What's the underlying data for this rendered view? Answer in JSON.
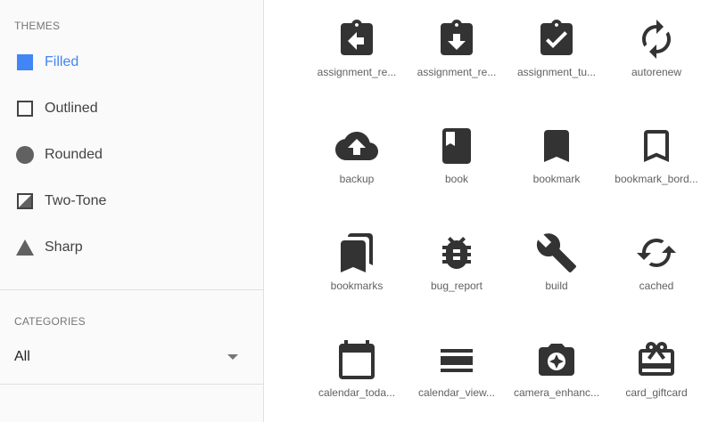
{
  "themes": {
    "heading": "THEMES",
    "items": [
      {
        "label": "Filled",
        "icon": "filled-square-icon",
        "selected": true
      },
      {
        "label": "Outlined",
        "icon": "outlined-square-icon",
        "selected": false
      },
      {
        "label": "Rounded",
        "icon": "rounded-circle-icon",
        "selected": false
      },
      {
        "label": "Two-Tone",
        "icon": "two-tone-icon",
        "selected": false
      },
      {
        "label": "Sharp",
        "icon": "sharp-triangle-icon",
        "selected": false
      }
    ]
  },
  "categories": {
    "heading": "CATEGORIES",
    "selected_value": "All"
  },
  "colors": {
    "accent": "#4285f4",
    "icon": "#333333",
    "sidebar_bg": "#fafafa"
  },
  "icons": [
    {
      "name": "assignment_return",
      "label": "assignment_re..."
    },
    {
      "name": "assignment_returned",
      "label": "assignment_re..."
    },
    {
      "name": "assignment_turned_in",
      "label": "assignment_tu..."
    },
    {
      "name": "autorenew",
      "label": "autorenew"
    },
    {
      "name": "backup",
      "label": "backup"
    },
    {
      "name": "book",
      "label": "book"
    },
    {
      "name": "bookmark",
      "label": "bookmark"
    },
    {
      "name": "bookmark_border",
      "label": "bookmark_bord..."
    },
    {
      "name": "bookmarks",
      "label": "bookmarks"
    },
    {
      "name": "bug_report",
      "label": "bug_report"
    },
    {
      "name": "build",
      "label": "build"
    },
    {
      "name": "cached",
      "label": "cached"
    },
    {
      "name": "calendar_today",
      "label": "calendar_toda..."
    },
    {
      "name": "calendar_view_day",
      "label": "calendar_view..."
    },
    {
      "name": "camera_enhance",
      "label": "camera_enhanc..."
    },
    {
      "name": "card_giftcard",
      "label": "card_giftcard"
    }
  ]
}
